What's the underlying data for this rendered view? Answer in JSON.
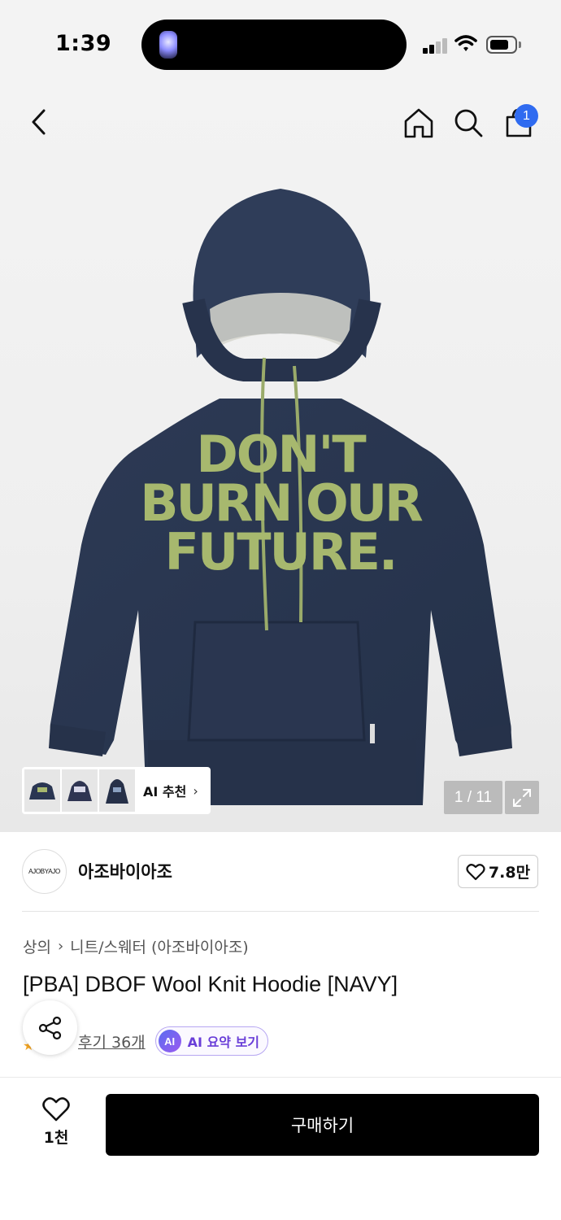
{
  "status_bar": {
    "time": "1:39"
  },
  "nav": {
    "back_icon": "chevron-left-icon",
    "home_icon": "home-icon",
    "search_icon": "search-icon",
    "cart_icon": "shopping-bag-icon",
    "cart_count": "1"
  },
  "gallery": {
    "ai_recommend_label": "AI 추천",
    "counter": "1 / 11"
  },
  "brand": {
    "logo_text": "AJOBYAJO",
    "name": "아조바이아조",
    "like_count": "7.8만"
  },
  "breadcrumb": {
    "level1": "상의",
    "level2": "니트/스웨터 (아조바이아조)"
  },
  "product": {
    "title": "[PBA] DBOF Wool Knit Hoodie [NAVY]",
    "review_link": "후기 36개",
    "ai_summary_badge": "AI",
    "ai_summary_label": "AI 요약 보기"
  },
  "bottom_bar": {
    "wish_count": "1천",
    "buy_label": "구매하기"
  },
  "colors": {
    "accent_blue": "#2f6bf0",
    "buy_button": "#000000",
    "ai_purple": "#6a3fd8"
  }
}
